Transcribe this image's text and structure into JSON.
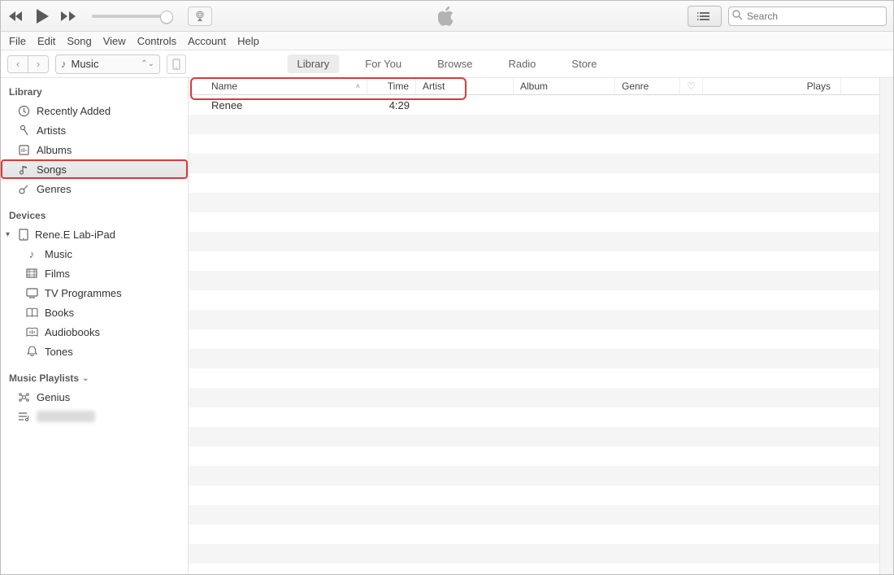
{
  "search": {
    "placeholder": "Search"
  },
  "menubar": [
    "File",
    "Edit",
    "Song",
    "View",
    "Controls",
    "Account",
    "Help"
  ],
  "category_selected": "Music",
  "tabs": [
    {
      "label": "Library",
      "active": true
    },
    {
      "label": "For You",
      "active": false
    },
    {
      "label": "Browse",
      "active": false
    },
    {
      "label": "Radio",
      "active": false
    },
    {
      "label": "Store",
      "active": false
    }
  ],
  "sidebar": {
    "library_header": "Library",
    "library_items": [
      {
        "icon": "clock",
        "label": "Recently Added"
      },
      {
        "icon": "mic",
        "label": "Artists"
      },
      {
        "icon": "album",
        "label": "Albums"
      },
      {
        "icon": "note",
        "label": "Songs",
        "selected": true,
        "highlighted": true
      },
      {
        "icon": "guitar",
        "label": "Genres"
      }
    ],
    "devices_header": "Devices",
    "device": {
      "label": "Rene.E Lab-iPad"
    },
    "device_children": [
      {
        "icon": "note",
        "label": "Music"
      },
      {
        "icon": "film",
        "label": "Films"
      },
      {
        "icon": "tv",
        "label": "TV Programmes"
      },
      {
        "icon": "book",
        "label": "Books"
      },
      {
        "icon": "audio",
        "label": "Audiobooks"
      },
      {
        "icon": "bell",
        "label": "Tones"
      }
    ],
    "playlists_header": "Music Playlists",
    "playlists": [
      {
        "icon": "genius",
        "label": "Genius"
      },
      {
        "icon": "list",
        "label": "",
        "blurred": true
      }
    ]
  },
  "columns": {
    "name": "Name",
    "time": "Time",
    "artist": "Artist",
    "album": "Album",
    "genre": "Genre",
    "plays": "Plays"
  },
  "rows": [
    {
      "name": "Renee",
      "time": "4:29",
      "artist": "",
      "album": "",
      "genre": "",
      "plays": "",
      "highlighted": true
    }
  ]
}
